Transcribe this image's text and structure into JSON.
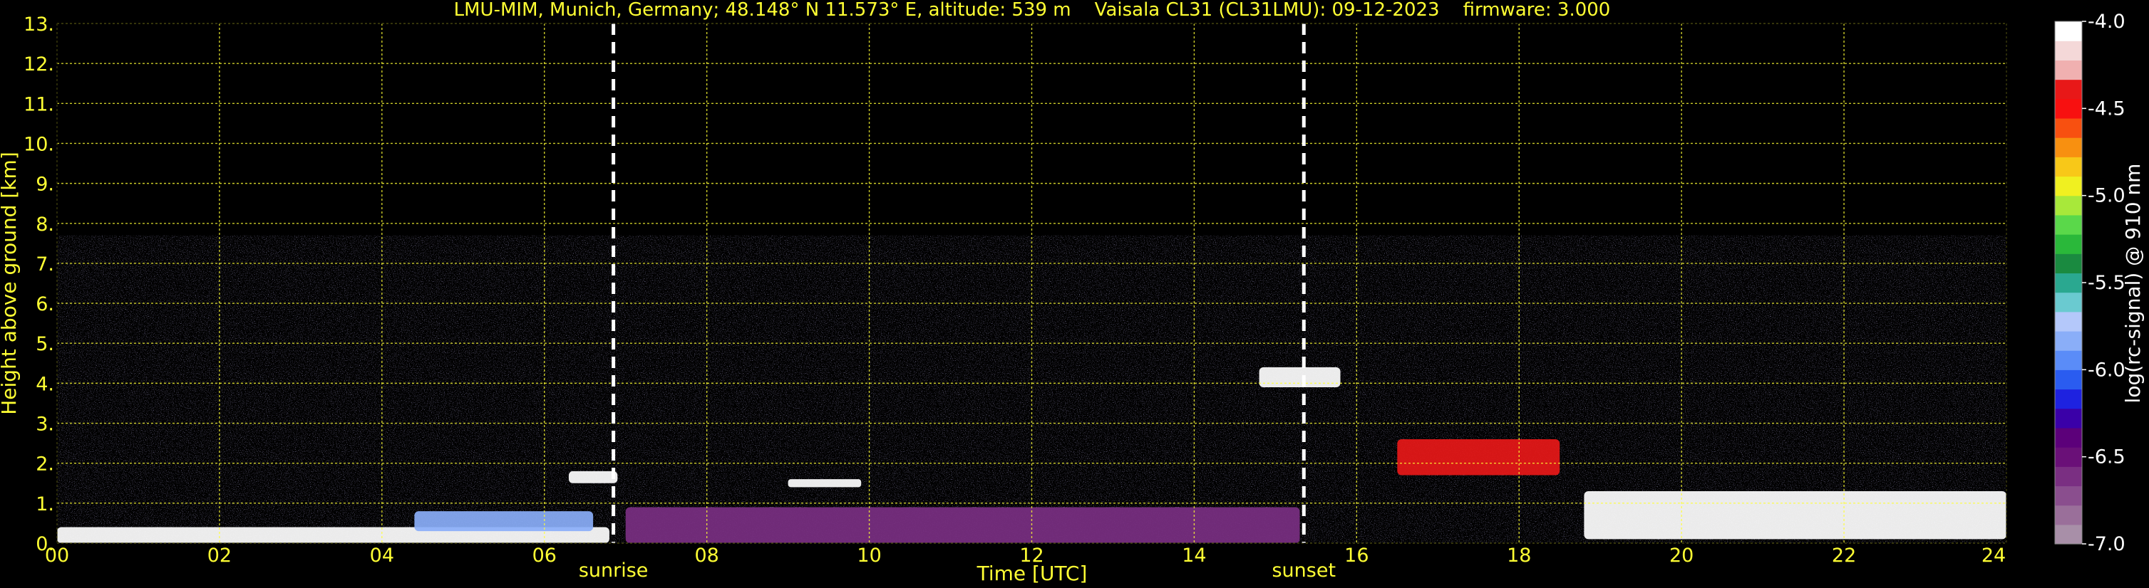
{
  "chart_data": {
    "type": "heatmap",
    "title": "LMU-MIM, Munich, Germany; 48.148° N 11.573° E, altitude: 539 m    Vaisala CL31 (CL31LMU): 09-12-2023    firmware: 3.000",
    "xlabel": "Time [UTC]",
    "ylabel": "Height above ground [km]",
    "xlim": [
      0,
      24
    ],
    "ylim": [
      0,
      13
    ],
    "x_ticks": [
      "00",
      "02",
      "04",
      "06",
      "08",
      "10",
      "12",
      "14",
      "16",
      "18",
      "20",
      "22",
      "24"
    ],
    "y_ticks": [
      "0.",
      "1.",
      "2.",
      "3.",
      "4.",
      "5.",
      "6.",
      "7.",
      "8.",
      "9.",
      "10.",
      "11.",
      "12.",
      "13."
    ],
    "grid": true,
    "grid_color": "#ffff33",
    "text_color": "#ffff33",
    "background": "#000000",
    "markers": [
      {
        "label": "sunrise",
        "x": 6.85
      },
      {
        "label": "sunset",
        "x": 15.35
      }
    ],
    "colorbar": {
      "label": "log(rc-signal) @ 910 nm",
      "range": [
        -7.0,
        -4.0
      ],
      "tick_labels": [
        "-7.0",
        "-6.5",
        "-6.0",
        "-5.5",
        "-5.0",
        "-4.5",
        "-4.0"
      ],
      "tick_values": [
        -7.0,
        -6.5,
        -6.0,
        -5.5,
        -5.0,
        -4.5,
        -4.0
      ],
      "colors": [
        "#a88fa8",
        "#9a6f9a",
        "#8a4e8e",
        "#7a2f82",
        "#6a1078",
        "#5c007a",
        "#3a00a8",
        "#1e22e0",
        "#2a5cf0",
        "#5a8cf8",
        "#8aaef8",
        "#b4c8fa",
        "#6acad0",
        "#2aa890",
        "#1a8a40",
        "#2ab83a",
        "#5ad84a",
        "#a8e83a",
        "#f0f020",
        "#f8c818",
        "#f89010",
        "#f85010",
        "#f81010",
        "#e81818",
        "#f0b0b0",
        "#f4d8d8",
        "#ffffff"
      ]
    },
    "features": [
      {
        "name": "noise region",
        "x_range": [
          0,
          24
        ],
        "height_range": [
          0,
          7.7
        ]
      },
      {
        "name": "surface layer",
        "x_range": [
          0,
          6.8
        ],
        "height_range": [
          0,
          0.4
        ],
        "level": -4.0
      },
      {
        "name": "aerosol layer",
        "x_range": [
          4.4,
          6.6
        ],
        "height_range": [
          0.3,
          0.8
        ],
        "level": -5.8
      },
      {
        "name": "cloud",
        "x_range": [
          6.3,
          6.9
        ],
        "height_range": [
          1.5,
          1.8
        ],
        "level": -4.0
      },
      {
        "name": "cloud",
        "x_range": [
          9.0,
          9.9
        ],
        "height_range": [
          1.4,
          1.6
        ],
        "level": -4.0
      },
      {
        "name": "boundary layer",
        "x_range": [
          7.0,
          15.3
        ],
        "height_range": [
          0,
          0.9
        ],
        "level": -6.6
      },
      {
        "name": "cloud",
        "x_range": [
          14.8,
          15.8
        ],
        "height_range": [
          3.9,
          4.4
        ],
        "level": -4.0
      },
      {
        "name": "cloud",
        "x_range": [
          16.5,
          18.5
        ],
        "height_range": [
          1.7,
          2.6
        ],
        "level": -4.3
      },
      {
        "name": "cloud",
        "x_range": [
          18.8,
          24
        ],
        "height_range": [
          0.1,
          1.3
        ],
        "level": -4.0
      }
    ]
  }
}
